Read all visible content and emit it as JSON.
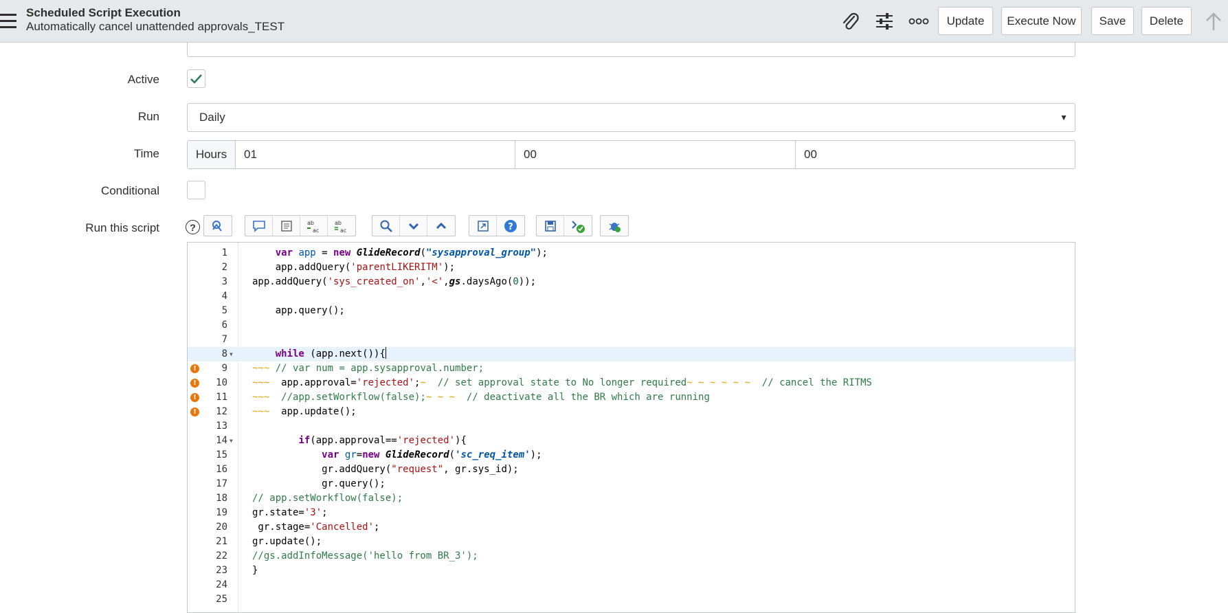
{
  "header": {
    "title": "Scheduled Script Execution",
    "subtitle": "Automatically cancel unattended approvals_TEST",
    "buttons": {
      "update": "Update",
      "execute_now": "Execute Now",
      "save": "Save",
      "delete": "Delete"
    },
    "icons": [
      "paperclip-icon",
      "sliders-icon",
      "more-icon",
      "arrow-up-icon"
    ]
  },
  "form": {
    "active_label": "Active",
    "active_checked": true,
    "run_label": "Run",
    "run_value": "Daily",
    "time_label": "Time",
    "time_addon": "Hours",
    "time_hours": "01",
    "time_minutes": "00",
    "time_seconds": "00",
    "conditional_label": "Conditional",
    "conditional_checked": false,
    "script_label": "Run this script",
    "help_glyph": "?"
  },
  "editor": {
    "lines": [
      {
        "n": "1",
        "text": "    var app = new GlideRecord(\"sysapproval_group\");"
      },
      {
        "n": "2",
        "text": "    app.addQuery('parentLIKERITM');"
      },
      {
        "n": "3",
        "text": "app.addQuery('sys_created_on','<',gs.daysAgo(0));"
      },
      {
        "n": "4",
        "text": ""
      },
      {
        "n": "5",
        "text": "    app.query();"
      },
      {
        "n": "6",
        "text": ""
      },
      {
        "n": "7",
        "text": ""
      },
      {
        "n": "8",
        "text": "    while (app.next()){"
      },
      {
        "n": "9",
        "text": " // var num = app.sysapproval.number;"
      },
      {
        "n": "10",
        "text": "  app.approval='rejected';  // set approval state to No longer required  // cancel the RITMS"
      },
      {
        "n": "11",
        "text": "  //app.setWorkflow(false);  // deactivate all the BR which are running"
      },
      {
        "n": "12",
        "text": "  app.update();"
      },
      {
        "n": "13",
        "text": ""
      },
      {
        "n": "14",
        "text": "        if(app.approval=='rejected'){"
      },
      {
        "n": "15",
        "text": "            var gr=new GlideRecord('sc_req_item');"
      },
      {
        "n": "16",
        "text": "            gr.addQuery(\"request\", gr.sys_id);"
      },
      {
        "n": "17",
        "text": "            gr.query();"
      },
      {
        "n": "18",
        "text": "// app.setWorkflow(false);"
      },
      {
        "n": "19",
        "text": "gr.state='3';"
      },
      {
        "n": "20",
        "text": " gr.stage='Cancelled';"
      },
      {
        "n": "21",
        "text": "gr.update();"
      },
      {
        "n": "22",
        "text": "//gs.addInfoMessage('hello from BR_3');"
      },
      {
        "n": "23",
        "text": "}"
      },
      {
        "n": "24",
        "text": ""
      },
      {
        "n": "25",
        "text": ""
      }
    ],
    "warning_lines": [
      "9",
      "10",
      "11",
      "12"
    ],
    "fold_lines": [
      "8",
      "14"
    ],
    "active_line": "8"
  },
  "toolbar": {
    "icons": [
      "script-tree-icon",
      "comment-icon",
      "format-icon",
      "replace-icon",
      "replace-all-icon",
      "search-icon",
      "search-next-icon",
      "search-prev-icon",
      "fullscreen-icon",
      "help-icon",
      "save-icon",
      "syntax-check-icon",
      "debug-icon"
    ]
  }
}
